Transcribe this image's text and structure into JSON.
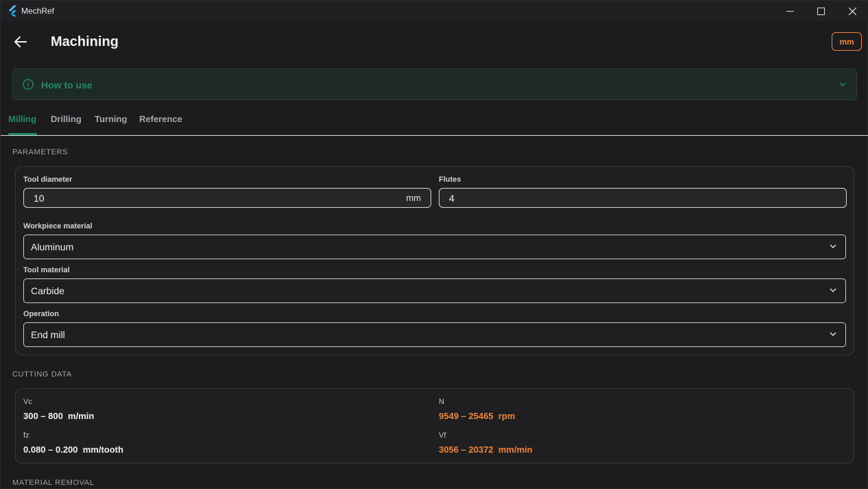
{
  "app": {
    "title": "MechRef"
  },
  "header": {
    "title": "Machining",
    "unit_toggle": "mm"
  },
  "howto": {
    "label": "How to use"
  },
  "tabs": [
    {
      "label": "Milling",
      "active": true
    },
    {
      "label": "Drilling",
      "active": false
    },
    {
      "label": "Turning",
      "active": false
    },
    {
      "label": "Reference",
      "active": false
    }
  ],
  "parameters": {
    "section_title": "PARAMETERS",
    "tool_diameter": {
      "label": "Tool diameter",
      "value": "10",
      "unit": "mm"
    },
    "flutes": {
      "label": "Flutes",
      "value": "4"
    },
    "workpiece_material": {
      "label": "Workpiece material",
      "value": "Aluminum"
    },
    "tool_material": {
      "label": "Tool material",
      "value": "Carbide"
    },
    "operation": {
      "label": "Operation",
      "value": "End mill"
    }
  },
  "cutting_data": {
    "section_title": "CUTTING DATA",
    "vc": {
      "label": "Vc",
      "value": "300 – 800  m/min"
    },
    "n": {
      "label": "N",
      "value": "9549 – 25465  rpm"
    },
    "fz": {
      "label": "fz",
      "value": "0.080 – 0.200  mm/tooth"
    },
    "vf": {
      "label": "Vf",
      "value": "3056 – 20372  mm/min"
    }
  },
  "material_removal": {
    "section_title": "MATERIAL REMOVAL"
  },
  "colors": {
    "accent": "#1f8a67",
    "highlight": "#f0853a",
    "background": "#1c1c1e"
  }
}
